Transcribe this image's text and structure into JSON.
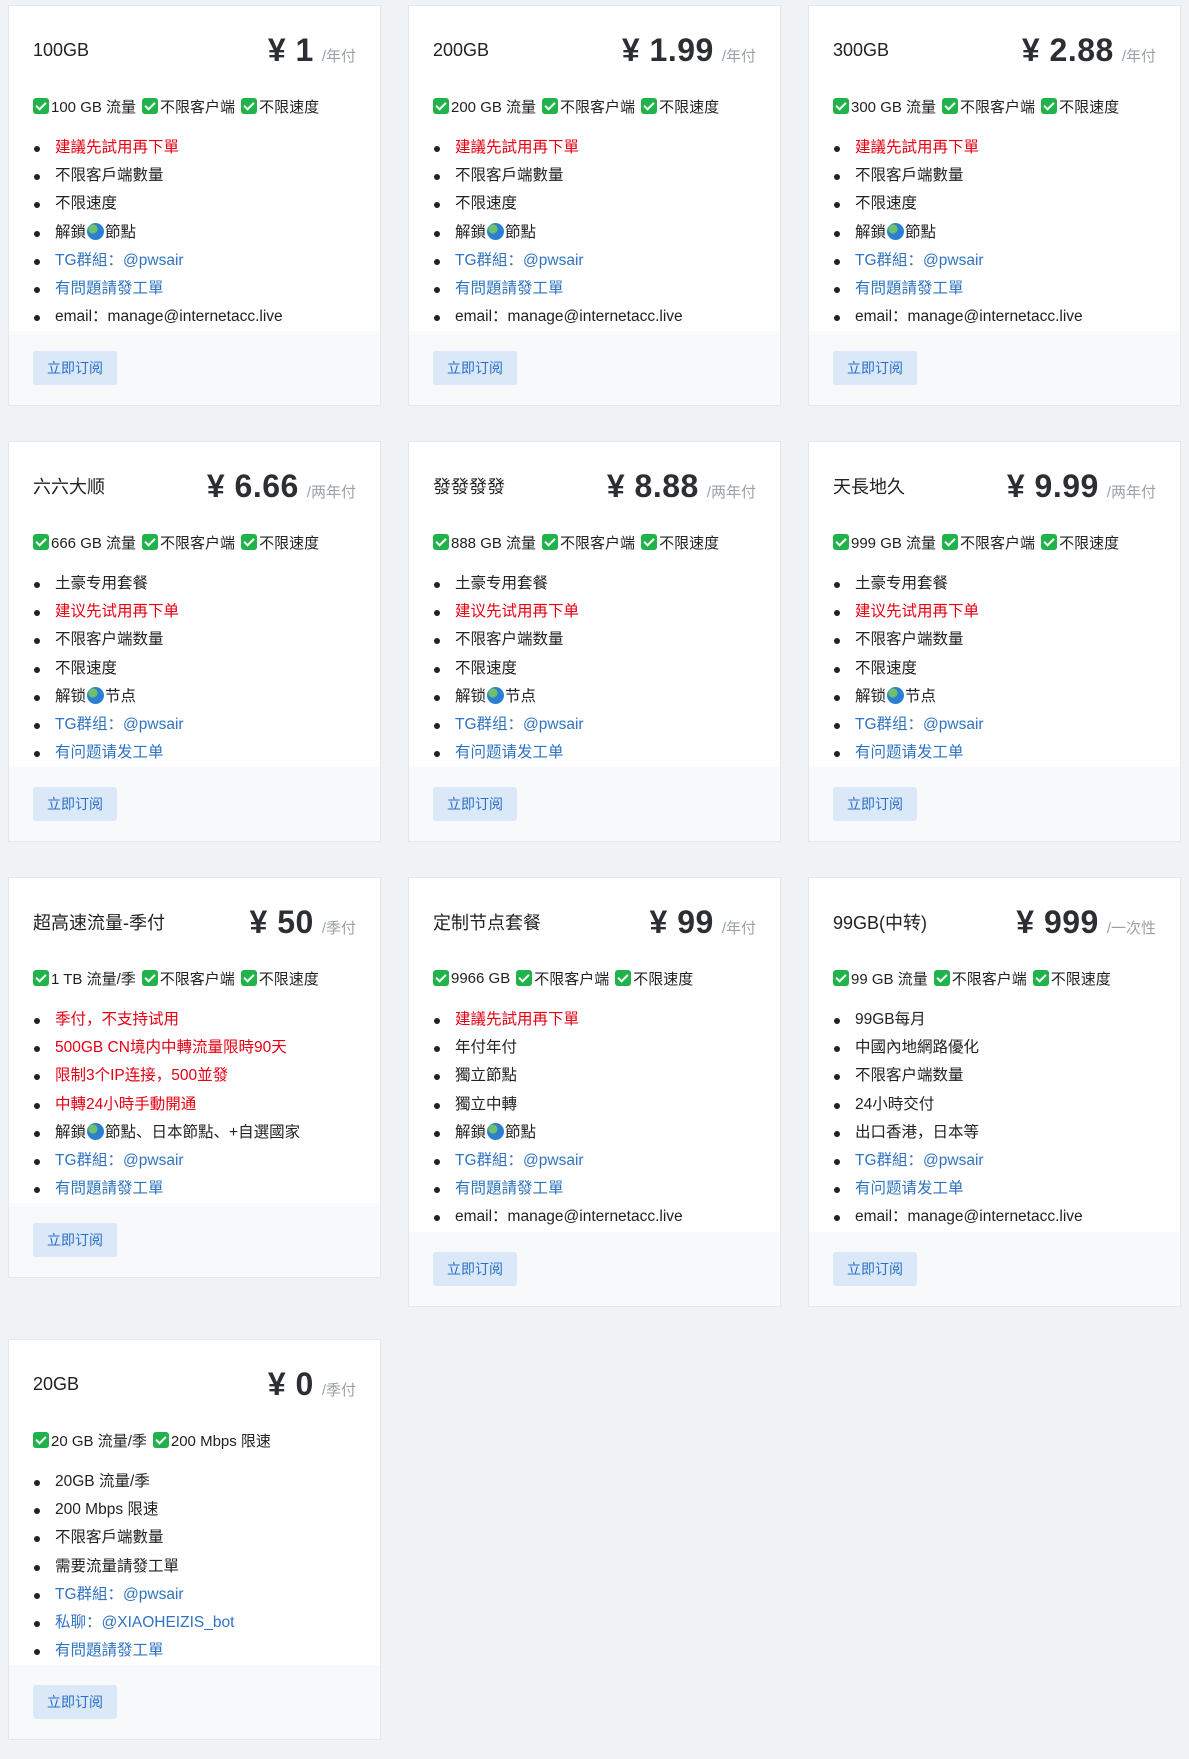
{
  "colors": {
    "accent": "#2f74c0",
    "warning": "#e60012",
    "check": "#20b24b",
    "button_bg": "#dbe8f7"
  },
  "plans": [
    {
      "name": "100GB",
      "price": "¥ 1",
      "period": "/年付",
      "tags": [
        "100 GB 流量",
        "不限客户端",
        "不限速度"
      ],
      "features": [
        {
          "text": "建議先試用再下單",
          "style": "red"
        },
        {
          "text": "不限客戶端數量",
          "style": "normal"
        },
        {
          "text": "不限速度",
          "style": "normal"
        },
        {
          "pre": "解鎖",
          "post": "節點",
          "style": "globe"
        },
        {
          "text": "TG群組：@pwsair",
          "style": "blue"
        },
        {
          "text": "有問題請發工單",
          "style": "blue"
        },
        {
          "text": "email：manage@internetacc.live",
          "style": "normal"
        }
      ],
      "button": "立即订阅"
    },
    {
      "name": "200GB",
      "price": "¥ 1.99",
      "period": "/年付",
      "tags": [
        "200 GB 流量",
        "不限客户端",
        "不限速度"
      ],
      "features": [
        {
          "text": "建議先試用再下單",
          "style": "red"
        },
        {
          "text": "不限客戶端數量",
          "style": "normal"
        },
        {
          "text": "不限速度",
          "style": "normal"
        },
        {
          "pre": "解鎖",
          "post": "節點",
          "style": "globe"
        },
        {
          "text": "TG群組：@pwsair",
          "style": "blue"
        },
        {
          "text": "有問題請發工單",
          "style": "blue"
        },
        {
          "text": "email：manage@internetacc.live",
          "style": "normal"
        }
      ],
      "button": "立即订阅"
    },
    {
      "name": "300GB",
      "price": "¥ 2.88",
      "period": "/年付",
      "tags": [
        "300 GB 流量",
        "不限客户端",
        "不限速度"
      ],
      "features": [
        {
          "text": "建議先試用再下單",
          "style": "red"
        },
        {
          "text": "不限客戶端數量",
          "style": "normal"
        },
        {
          "text": "不限速度",
          "style": "normal"
        },
        {
          "pre": "解鎖",
          "post": "節點",
          "style": "globe"
        },
        {
          "text": "TG群組：@pwsair",
          "style": "blue"
        },
        {
          "text": "有問題請發工單",
          "style": "blue"
        },
        {
          "text": "email：manage@internetacc.live",
          "style": "normal"
        }
      ],
      "button": "立即订阅"
    },
    {
      "name": "六六大顺",
      "price": "¥ 6.66",
      "period": "/两年付",
      "tags": [
        "666 GB 流量",
        "不限客户端",
        "不限速度"
      ],
      "features": [
        {
          "text": "土豪专用套餐",
          "style": "normal"
        },
        {
          "text": "建议先试用再下单",
          "style": "red"
        },
        {
          "text": "不限客户端数量",
          "style": "normal"
        },
        {
          "text": "不限速度",
          "style": "normal"
        },
        {
          "pre": "解锁",
          "post": "节点",
          "style": "globe"
        },
        {
          "text": "TG群组：@pwsair",
          "style": "blue"
        },
        {
          "text": "有问题请发工单",
          "style": "blue"
        }
      ],
      "button": "立即订阅"
    },
    {
      "name": "發發發發",
      "price": "¥ 8.88",
      "period": "/两年付",
      "tags": [
        "888 GB 流量",
        "不限客户端",
        "不限速度"
      ],
      "features": [
        {
          "text": "土豪专用套餐",
          "style": "normal"
        },
        {
          "text": "建议先试用再下单",
          "style": "red"
        },
        {
          "text": "不限客户端数量",
          "style": "normal"
        },
        {
          "text": "不限速度",
          "style": "normal"
        },
        {
          "pre": "解锁",
          "post": "节点",
          "style": "globe"
        },
        {
          "text": "TG群组：@pwsair",
          "style": "blue"
        },
        {
          "text": "有问题请发工单",
          "style": "blue"
        }
      ],
      "button": "立即订阅"
    },
    {
      "name": "天長地久",
      "price": "¥ 9.99",
      "period": "/两年付",
      "tags": [
        "999 GB 流量",
        "不限客户端",
        "不限速度"
      ],
      "features": [
        {
          "text": "土豪专用套餐",
          "style": "normal"
        },
        {
          "text": "建议先试用再下单",
          "style": "red"
        },
        {
          "text": "不限客户端数量",
          "style": "normal"
        },
        {
          "text": "不限速度",
          "style": "normal"
        },
        {
          "pre": "解锁",
          "post": "节点",
          "style": "globe"
        },
        {
          "text": "TG群组：@pwsair",
          "style": "blue"
        },
        {
          "text": "有问题请发工单",
          "style": "blue"
        }
      ],
      "button": "立即订阅"
    },
    {
      "name": "超高速流量-季付",
      "price": "¥ 50",
      "period": "/季付",
      "tags": [
        "1 TB 流量/季",
        "不限客户端",
        "不限速度"
      ],
      "features": [
        {
          "text": "季付，不支持试用",
          "style": "red"
        },
        {
          "text": "500GB CN境内中轉流量限時90天",
          "style": "red"
        },
        {
          "text": "限制3个IP连接，500並發",
          "style": "red"
        },
        {
          "text": "中轉24小時手動開通",
          "style": "red"
        },
        {
          "pre": "解鎖",
          "post": "節點、日本節點、+自選國家",
          "style": "globe"
        },
        {
          "text": "TG群組：@pwsair",
          "style": "blue"
        },
        {
          "text": "有問題請發工單",
          "style": "blue"
        }
      ],
      "button": "立即订阅"
    },
    {
      "name": "定制节点套餐",
      "price": "¥ 99",
      "period": "/年付",
      "tags": [
        "9966 GB",
        "不限客户端",
        "不限速度"
      ],
      "features": [
        {
          "text": "建議先試用再下單",
          "style": "red"
        },
        {
          "text": "年付年付",
          "style": "normal"
        },
        {
          "text": "獨立節點",
          "style": "normal"
        },
        {
          "text": "獨立中轉",
          "style": "normal"
        },
        {
          "pre": "解鎖",
          "post": "節點",
          "style": "globe"
        },
        {
          "text": "TG群組：@pwsair",
          "style": "blue"
        },
        {
          "text": "有問題請發工單",
          "style": "blue"
        },
        {
          "text": "email：manage@internetacc.live",
          "style": "normal"
        }
      ],
      "button": "立即订阅"
    },
    {
      "name": "99GB(中转)",
      "price": "¥ 999",
      "period": "/一次性",
      "tags": [
        " 99 GB 流量",
        "不限客户端",
        "不限速度"
      ],
      "features": [
        {
          "text": "99GB每月",
          "style": "normal"
        },
        {
          "text": "中國內地網路優化",
          "style": "normal"
        },
        {
          "text": "不限客户端数量",
          "style": "normal"
        },
        {
          "text": "24小時交付",
          "style": "normal"
        },
        {
          "text": "出口香港，日本等",
          "style": "normal"
        },
        {
          "text": "TG群組：@pwsair",
          "style": "blue"
        },
        {
          "text": "有问题请发工单",
          "style": "blue"
        },
        {
          "text": "email：manage@internetacc.live",
          "style": "normal"
        }
      ],
      "button": "立即订阅"
    },
    {
      "name": "20GB",
      "price": "¥ 0",
      "period": "/季付",
      "tags": [
        "20 GB 流量/季",
        "200 Mbps 限速"
      ],
      "features": [
        {
          "text": "20GB 流量/季",
          "style": "normal"
        },
        {
          "text": "200 Mbps 限速",
          "style": "normal"
        },
        {
          "text": "不限客戶端數量",
          "style": "normal"
        },
        {
          "text": "需要流量請發工單",
          "style": "normal"
        },
        {
          "text": "TG群組：@pwsair",
          "style": "blue"
        },
        {
          "text": "私聊：@XIAOHEIZIS_bot",
          "style": "blue"
        },
        {
          "text": "有問題請發工單",
          "style": "blue"
        }
      ],
      "button": "立即订阅"
    }
  ]
}
